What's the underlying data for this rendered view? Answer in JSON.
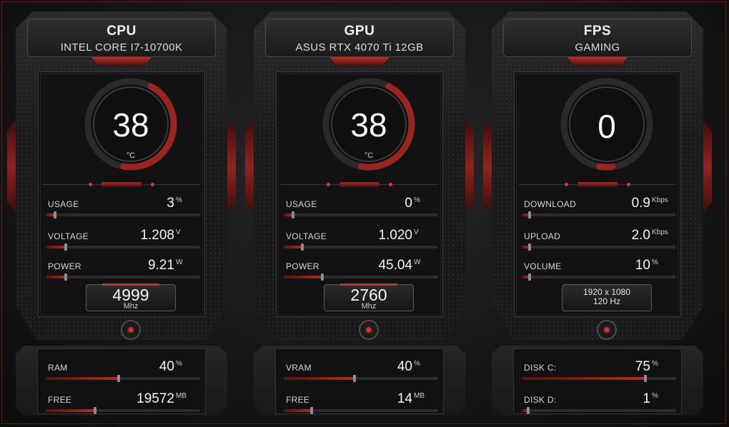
{
  "colors": {
    "accent": "#b52b25",
    "background": "#161617"
  },
  "panels": [
    {
      "id": "cpu",
      "title": "CPU",
      "subtitle": "INTEL CORE I7-10700K",
      "gauge": {
        "value": "38",
        "unit": "°C",
        "fraction": 0.45
      },
      "metrics": [
        {
          "label": "USAGE",
          "value": "3",
          "unit": "%",
          "fraction": 0.06
        },
        {
          "label": "VOLTAGE",
          "value": "1.208",
          "unit": "V",
          "fraction": 0.13
        },
        {
          "label": "POWER",
          "value": "9.21",
          "unit": "W",
          "fraction": 0.13
        }
      ],
      "clock": {
        "value": "4999",
        "unit": "Mhz"
      },
      "bottom": [
        {
          "label": "RAM",
          "value": "40",
          "unit": "%",
          "fraction": 0.47
        },
        {
          "label": "FREE",
          "value": "19572",
          "unit": "MB",
          "fraction": 0.32
        }
      ]
    },
    {
      "id": "gpu",
      "title": "GPU",
      "subtitle": "ASUS RTX 4070 Ti 12GB",
      "gauge": {
        "value": "38",
        "unit": "°C",
        "fraction": 0.45
      },
      "metrics": [
        {
          "label": "USAGE",
          "value": "0",
          "unit": "%",
          "fraction": 0.06
        },
        {
          "label": "VOLTAGE",
          "value": "1.020",
          "unit": "V",
          "fraction": 0.12
        },
        {
          "label": "POWER",
          "value": "45.04",
          "unit": "W",
          "fraction": 0.25
        }
      ],
      "clock": {
        "value": "2760",
        "unit": "Mhz"
      },
      "bottom": [
        {
          "label": "VRAM",
          "value": "40",
          "unit": "%",
          "fraction": 0.46
        },
        {
          "label": "FREE",
          "value": "14",
          "unit": "MB",
          "fraction": 0.18
        }
      ]
    },
    {
      "id": "fps",
      "title": "FPS",
      "subtitle": "GAMING",
      "gauge": {
        "value": "0",
        "unit": "",
        "fraction": 0.05
      },
      "metrics": [
        {
          "label": "DOWNLOAD",
          "value": "0.9",
          "unit": "Kbps",
          "fraction": 0.05
        },
        {
          "label": "UPLOAD",
          "value": "2.0",
          "unit": "Kbps",
          "fraction": 0.05
        },
        {
          "label": "VOLUME",
          "value": "10",
          "unit": "%",
          "fraction": 0.05
        }
      ],
      "display": {
        "resolution": "1920 x 1080",
        "refresh": "120 Hz"
      },
      "bottom": [
        {
          "label": "DISK C:",
          "value": "75",
          "unit": "%",
          "fraction": 0.8
        },
        {
          "label": "DISK D:",
          "value": "1",
          "unit": "%",
          "fraction": 0.04
        }
      ]
    }
  ]
}
